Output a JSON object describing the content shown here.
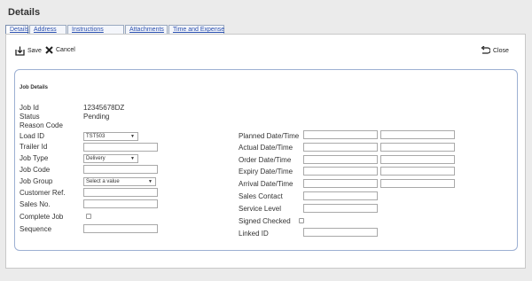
{
  "window": {
    "title": "Details"
  },
  "tabs": [
    "Details",
    "Address",
    "Instructions",
    "Attachments",
    "Time and Expense"
  ],
  "toolbar": {
    "save_label": "Save",
    "cancel_label": "Cancel",
    "close_label": "Close"
  },
  "job_details": {
    "title": "Job Details",
    "job_id_label": "Job Id",
    "job_id": "12345678DZ",
    "status_label": "Status",
    "status": "Pending",
    "reason_code_label": "Reason Code",
    "load_id_label": "Load ID",
    "load_id": "TST503",
    "trailer_id_label": "Trailer Id",
    "job_type_label": "Job Type",
    "job_type": "Delivery",
    "job_code_label": "Job Code",
    "job_group_label": "Job Group",
    "job_group": "Select a value",
    "customer_ref_label": "Customer Ref.",
    "sales_no_label": "Sales No.",
    "complete_job_label": "Complete Job",
    "sequence_label": "Sequence",
    "planned_label": "Planned Date/Time",
    "actual_label": "Actual Date/Time",
    "order_label": "Order Date/Time",
    "expiry_label": "Expiry Date/Time",
    "arrival_label": "Arrival Date/Time",
    "sales_contact_label": "Sales Contact",
    "service_level_label": "Service Level",
    "signed_checked_label": "Signed Checked",
    "linked_id_label": "Linked ID"
  }
}
